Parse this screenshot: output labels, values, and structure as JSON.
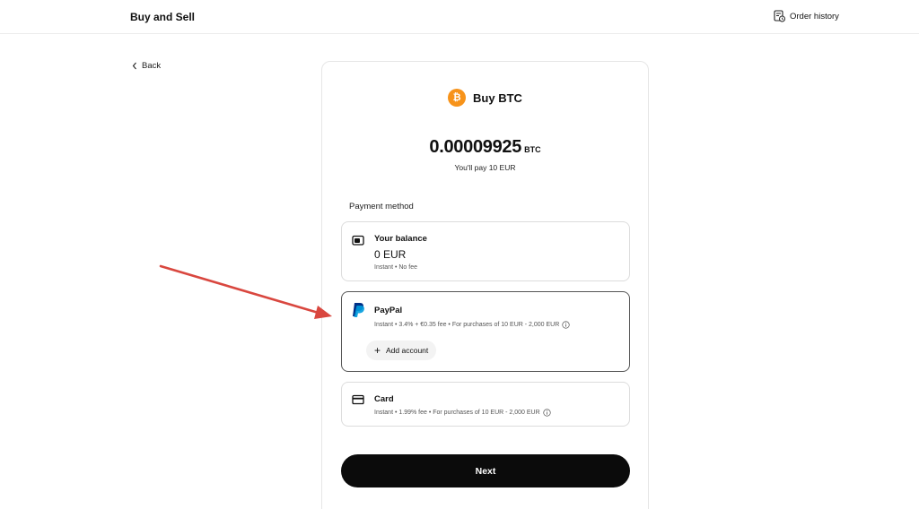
{
  "header": {
    "title": "Buy and Sell",
    "order_history_label": "Order history"
  },
  "nav": {
    "back_label": "Back"
  },
  "purchase": {
    "title": "Buy BTC",
    "coin_symbol": "₿",
    "amount": "0.00009925",
    "amount_unit": "BTC",
    "pay_note": "You'll pay 10 EUR"
  },
  "payment": {
    "section_label": "Payment method",
    "balance": {
      "title": "Your balance",
      "amount": "0 EUR",
      "details": "Instant • No fee"
    },
    "paypal": {
      "title": "PayPal",
      "details": "Instant • 3.4% + €0.35 fee • For purchases of 10 EUR - 2,000 EUR",
      "add_account_label": "Add account",
      "selected": true
    },
    "card": {
      "title": "Card",
      "details": "Instant • 1.99% fee • For purchases of 10 EUR - 2,000 EUR"
    }
  },
  "next_label": "Next",
  "colors": {
    "btc_orange": "#f7931a",
    "paypal_dark": "#003087",
    "paypal_light": "#009cde",
    "annotation_arrow": "#d9473f",
    "button_black": "#0b0b0b"
  }
}
